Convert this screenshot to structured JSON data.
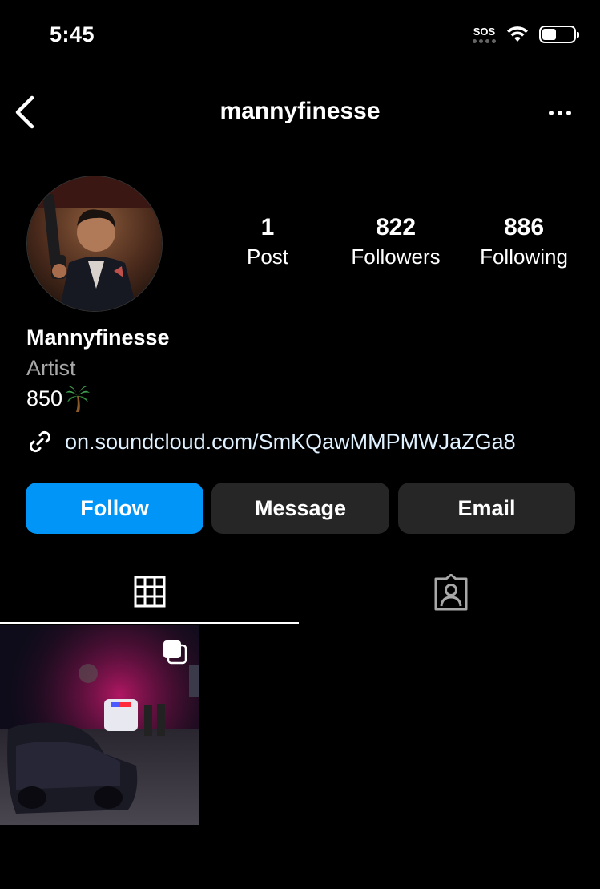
{
  "status_bar": {
    "time": "5:45",
    "sos_label": "SOS",
    "battery_level": 0.45
  },
  "header": {
    "username": "mannyfinesse"
  },
  "profile": {
    "stats": [
      {
        "value": "1",
        "label": "Post"
      },
      {
        "value": "822",
        "label": "Followers"
      },
      {
        "value": "886",
        "label": "Following"
      }
    ],
    "display_name": "Mannyfinesse",
    "category": "Artist",
    "bio": "850",
    "bio_emoji": "palm-tree",
    "link": "on.soundcloud.com/SmKQawMMPMWJaZGa8"
  },
  "actions": {
    "follow": "Follow",
    "message": "Message",
    "email": "Email"
  },
  "tabs": {
    "active": "grid",
    "items": [
      "grid",
      "tagged"
    ]
  },
  "posts": [
    {
      "type": "carousel"
    }
  ],
  "colors": {
    "accent": "#0095f6",
    "secondary_button": "#262626",
    "muted_text": "#a8a8a8",
    "link_text": "#e0f1ff"
  }
}
